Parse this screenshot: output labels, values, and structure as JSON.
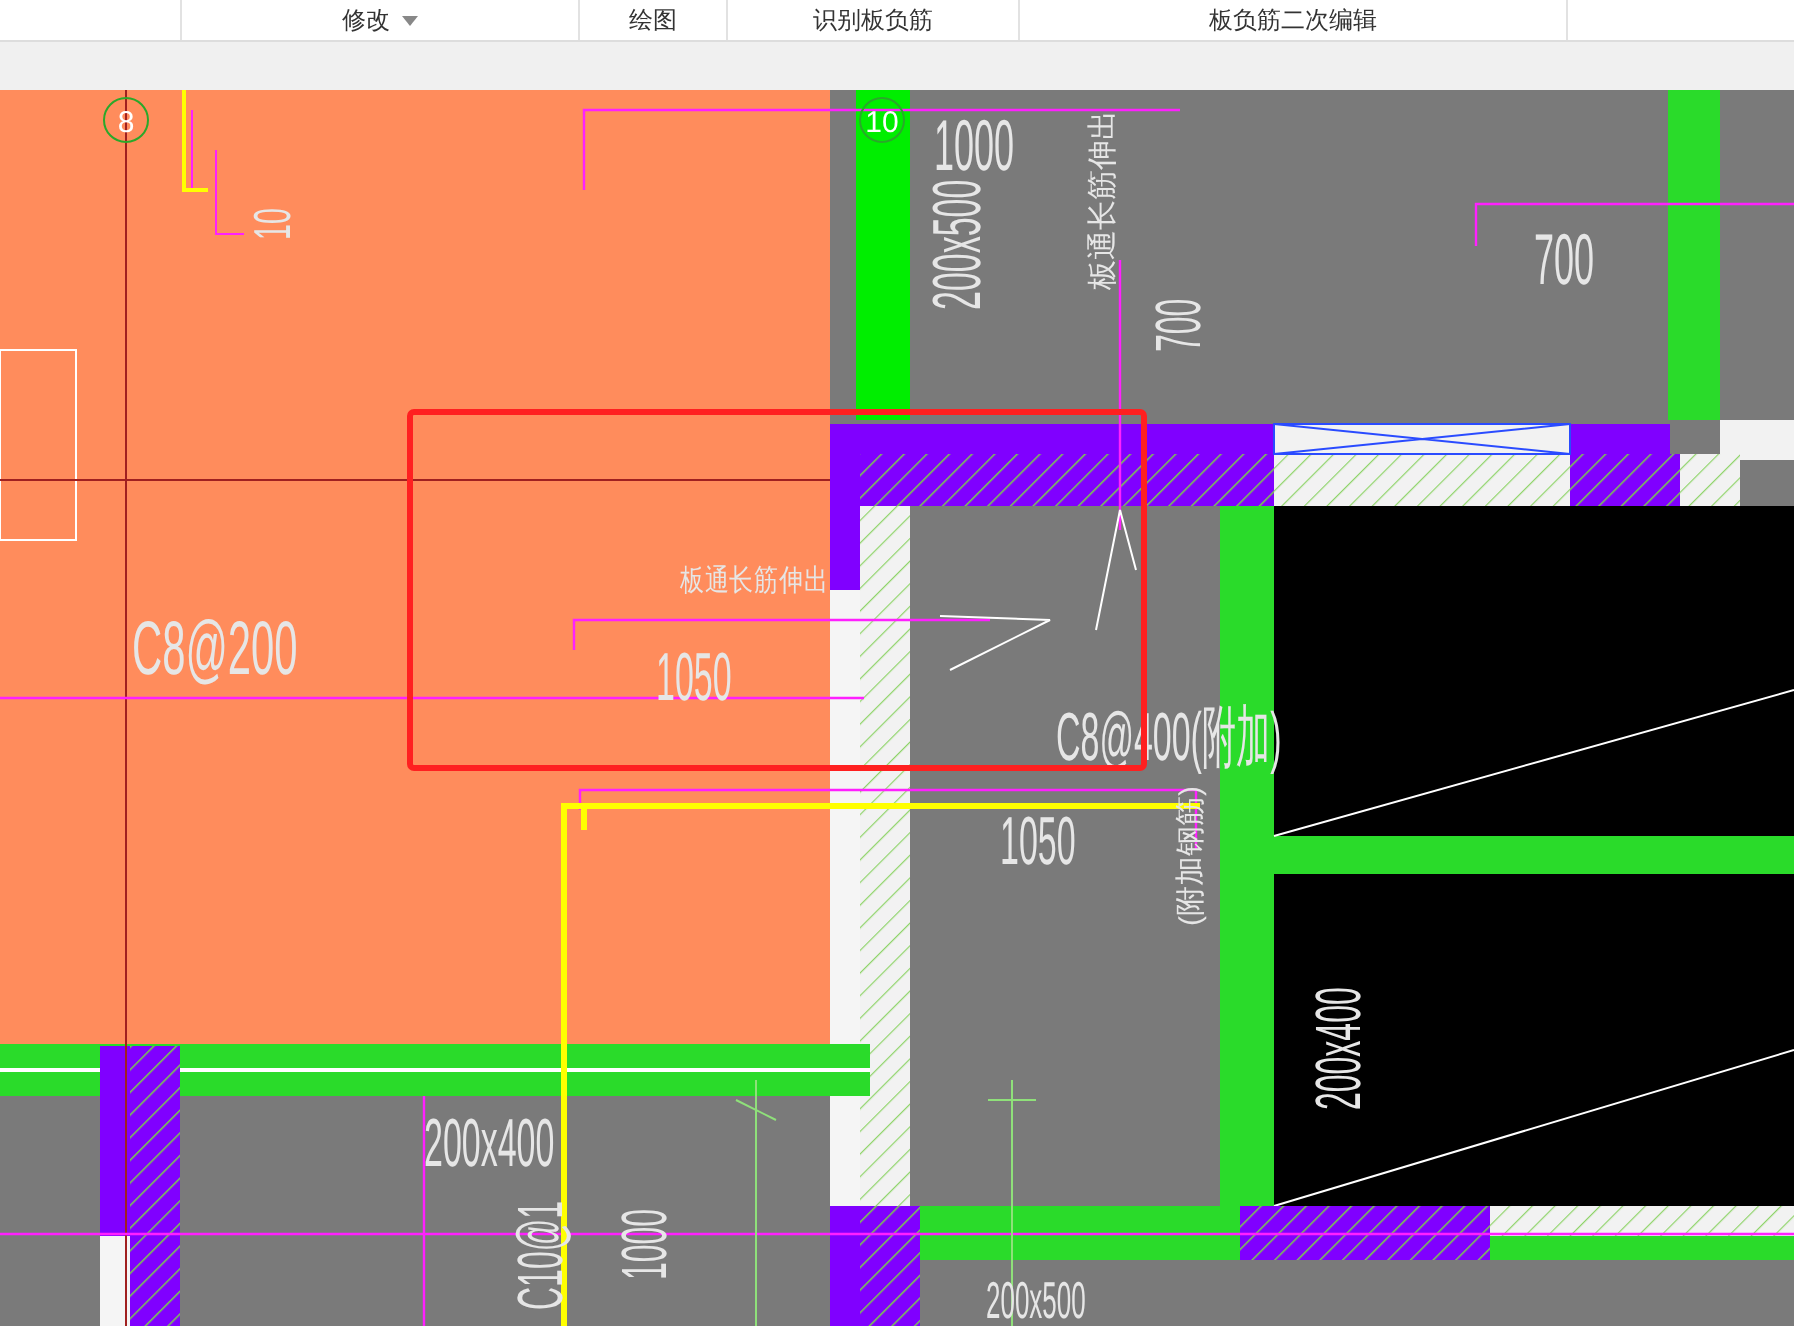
{
  "toolbar": {
    "items": [
      {
        "label": "修改",
        "dropdown": true
      },
      {
        "label": "绘图",
        "dropdown": false
      },
      {
        "label": "识别板负筋",
        "dropdown": false
      },
      {
        "label": "板负筋二次编辑",
        "dropdown": false
      }
    ]
  },
  "drawing": {
    "axis_markers": [
      {
        "label": "8"
      },
      {
        "label": "10"
      }
    ],
    "annotations": [
      {
        "text": "10",
        "vertical": true
      },
      {
        "text": "1000",
        "vertical": false
      },
      {
        "text": "200x500",
        "vertical": true
      },
      {
        "text": "板通长筋伸出",
        "vertical": true
      },
      {
        "text": "700",
        "vertical": true
      },
      {
        "text": "700",
        "vertical": false
      },
      {
        "text": "C8@200",
        "vertical": false
      },
      {
        "text": "板通长筋伸出",
        "vertical": false
      },
      {
        "text": "1050",
        "vertical": false
      },
      {
        "text": "C8@400(附加)",
        "vertical": false
      },
      {
        "text": "1050",
        "vertical": false
      },
      {
        "text": "(附加钢筋)",
        "vertical": true
      },
      {
        "text": "200x400",
        "vertical": true
      },
      {
        "text": "200x400",
        "vertical": false
      },
      {
        "text": "C10@1",
        "vertical": true
      },
      {
        "text": "1000",
        "vertical": true
      },
      {
        "text": "200x500",
        "vertical": false
      }
    ],
    "selection_box": true
  }
}
